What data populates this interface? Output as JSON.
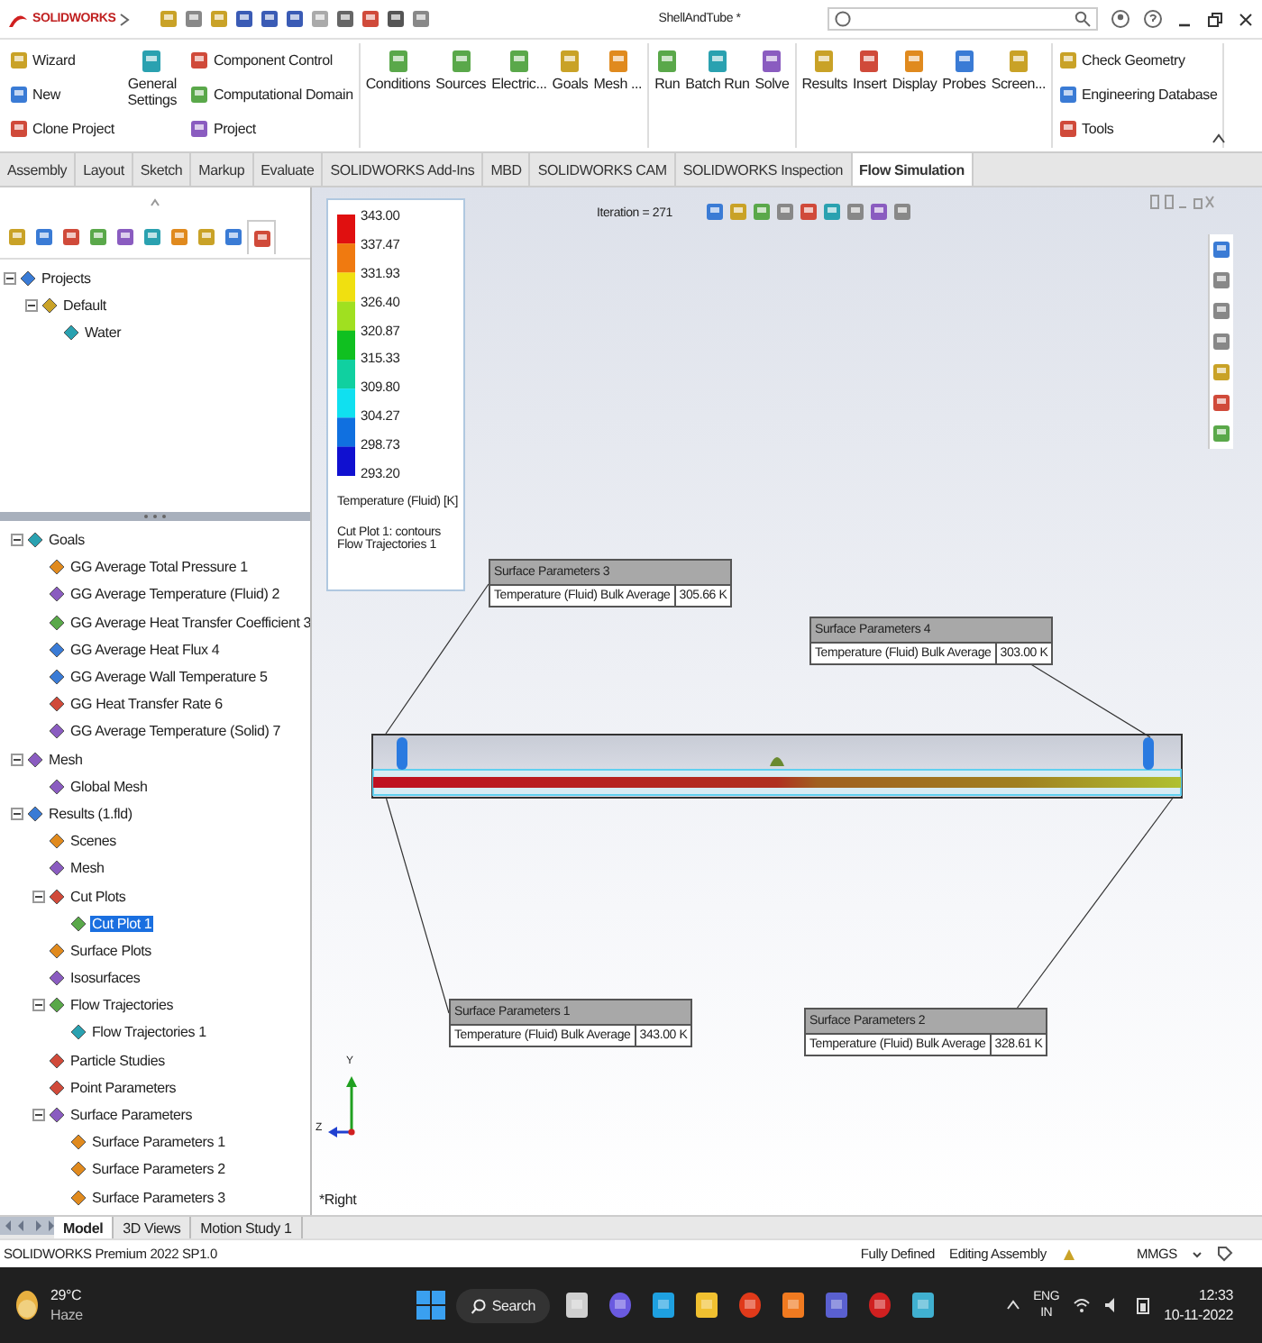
{
  "title_bar": {
    "app_name": "SOLIDWORKS",
    "document": "ShellAndTube *"
  },
  "ribbon": {
    "sections": [
      {
        "buttons": [
          {
            "kind": "stack",
            "items": [
              "Wizard",
              "New",
              "Clone Project"
            ]
          },
          {
            "kind": "big",
            "label": "General Settings"
          },
          {
            "kind": "stack",
            "items": [
              "Component Control",
              "Computational Domain",
              "Project"
            ]
          }
        ]
      },
      {
        "buttons": [
          {
            "kind": "big",
            "label": "Conditions"
          },
          {
            "kind": "big",
            "label": "Sources"
          },
          {
            "kind": "big",
            "label": "Electric..."
          },
          {
            "kind": "big",
            "label": "Goals"
          },
          {
            "kind": "big",
            "label": "Mesh ..."
          }
        ]
      },
      {
        "buttons": [
          {
            "kind": "big",
            "label": "Run"
          },
          {
            "kind": "big",
            "label": "Batch Run"
          },
          {
            "kind": "big",
            "label": "Solve"
          }
        ]
      },
      {
        "buttons": [
          {
            "kind": "big",
            "label": "Results"
          },
          {
            "kind": "big",
            "label": "Insert"
          },
          {
            "kind": "big",
            "label": "Display"
          },
          {
            "kind": "big",
            "label": "Probes"
          },
          {
            "kind": "big",
            "label": "Screen..."
          }
        ]
      },
      {
        "buttons": [
          {
            "kind": "stack",
            "items": [
              "Check Geometry",
              "Engineering Database",
              "Tools"
            ]
          }
        ]
      }
    ]
  },
  "tabs": [
    {
      "label": "Assembly",
      "selected": false
    },
    {
      "label": "Layout",
      "selected": false
    },
    {
      "label": "Sketch",
      "selected": false
    },
    {
      "label": "Markup",
      "selected": false
    },
    {
      "label": "Evaluate",
      "selected": false
    },
    {
      "label": "SOLIDWORKS Add-Ins",
      "selected": false
    },
    {
      "label": "MBD",
      "selected": false
    },
    {
      "label": "SOLIDWORKS CAM",
      "selected": false
    },
    {
      "label": "SOLIDWORKS Inspection",
      "selected": false
    },
    {
      "label": "Flow Simulation",
      "selected": true
    }
  ],
  "upper_tree": [
    {
      "label": "Projects",
      "selected": false,
      "expanded": true,
      "children": [
        {
          "label": "Default",
          "selected": false,
          "expanded": true,
          "children": [
            {
              "label": "Water",
              "selected": false
            }
          ]
        }
      ]
    }
  ],
  "lower_tree": [
    {
      "label": "Goals",
      "selected": false,
      "expanded": true,
      "children": [
        {
          "label": "GG Average Total Pressure 1",
          "selected": false
        },
        {
          "label": "GG Average Temperature (Fluid) 2",
          "selected": false
        },
        {
          "label": "GG Average Heat Transfer Coefficient 3",
          "selected": false
        },
        {
          "label": "GG Average Heat Flux 4",
          "selected": false
        },
        {
          "label": "GG Average Wall Temperature 5",
          "selected": false
        },
        {
          "label": "GG Heat Transfer Rate 6",
          "selected": false
        },
        {
          "label": "GG Average Temperature (Solid) 7",
          "selected": false
        }
      ]
    },
    {
      "label": "Mesh",
      "selected": false,
      "expanded": true,
      "children": [
        {
          "label": "Global Mesh",
          "selected": false
        }
      ]
    },
    {
      "label": "Results (1.fld)",
      "selected": false,
      "expanded": true,
      "children": [
        {
          "label": "Scenes",
          "selected": false
        },
        {
          "label": "Mesh",
          "selected": false
        },
        {
          "label": "Cut Plots",
          "selected": false,
          "expanded": true,
          "children": [
            {
              "label": "Cut Plot 1",
              "selected": true
            }
          ]
        },
        {
          "label": "Surface Plots",
          "selected": false
        },
        {
          "label": "Isosurfaces",
          "selected": false
        },
        {
          "label": "Flow Trajectories",
          "selected": false,
          "expanded": true,
          "children": [
            {
              "label": "Flow Trajectories 1",
              "selected": false
            }
          ]
        },
        {
          "label": "Particle Studies",
          "selected": false
        },
        {
          "label": "Point Parameters",
          "selected": false
        },
        {
          "label": "Surface Parameters",
          "selected": false,
          "expanded": true,
          "children": [
            {
              "label": "Surface Parameters 1",
              "selected": false
            },
            {
              "label": "Surface Parameters 2",
              "selected": false
            },
            {
              "label": "Surface Parameters 3",
              "selected": false
            }
          ]
        }
      ]
    }
  ],
  "viewport": {
    "iteration": "Iteration = 271",
    "legend": {
      "values": [
        "343.00",
        "337.47",
        "331.93",
        "326.40",
        "320.87",
        "315.33",
        "309.80",
        "304.27",
        "298.73",
        "293.20"
      ],
      "title": "Temperature (Fluid) [K]",
      "notes": [
        "Cut Plot 1: contours",
        "Flow Trajectories 1"
      ]
    },
    "callouts": [
      {
        "title": "Surface Parameters 3",
        "parameter": "Temperature (Fluid) Bulk Average",
        "value": "305.66 K"
      },
      {
        "title": "Surface Parameters 4",
        "parameter": "Temperature (Fluid) Bulk Average",
        "value": "303.00 K"
      },
      {
        "title": "Surface Parameters 1",
        "parameter": "Temperature (Fluid) Bulk Average",
        "value": "343.00 K"
      },
      {
        "title": "Surface Parameters 2",
        "parameter": "Temperature (Fluid) Bulk Average",
        "value": "328.61 K"
      }
    ],
    "triad_labels": [
      "Y",
      "Z"
    ],
    "view_name": "*Right"
  },
  "bottom_tabs": [
    {
      "label": "Model",
      "selected": true
    },
    {
      "label": "3D Views",
      "selected": false
    },
    {
      "label": "Motion Study 1",
      "selected": false
    }
  ],
  "status_bar": {
    "product": "SOLIDWORKS Premium 2022 SP1.0",
    "items": [
      "Fully Defined",
      "Editing Assembly"
    ],
    "units": "MMGS"
  },
  "taskbar": {
    "temperature": "29°C",
    "weather": "Haze",
    "search": "Search",
    "language": "ENG",
    "region": "IN",
    "time": "12:33",
    "date": "10-11-2022"
  }
}
